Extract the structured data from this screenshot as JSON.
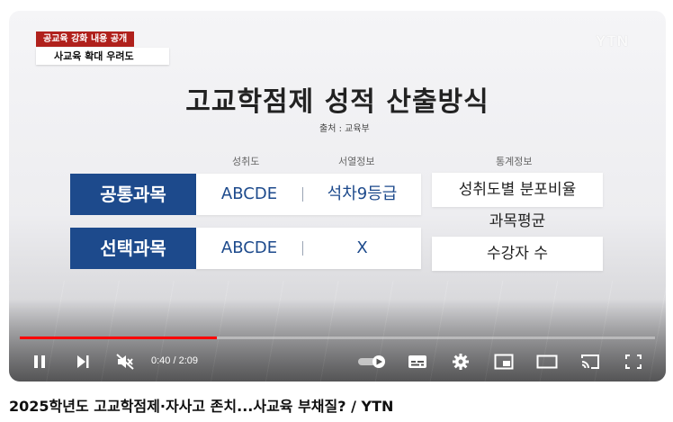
{
  "overlay": {
    "tag": "공교육 강화 내용 공개",
    "subtitle": "사교육 확대 우려도",
    "logo": "YTN"
  },
  "slide": {
    "title": "고교학점제 성적 산출방식",
    "source": "출처 : 교육부",
    "col_achievement": "성취도",
    "col_narrative": "서열정보",
    "col_stats": "통계정보",
    "rows": [
      {
        "subject": "공통과목",
        "achievement": "ABCDE",
        "rank": "석차9등급"
      },
      {
        "subject": "선택과목",
        "achievement": "ABCDE",
        "rank": "X"
      }
    ],
    "stats": [
      "성취도별 분포비율",
      "과목평균",
      "수강자 수"
    ]
  },
  "player": {
    "time": "0:40 / 2:09",
    "progress_fraction": 0.31,
    "progress_color": "#ff0000"
  },
  "video_title": "2025학년도 고교학점제·자사고 존치...사교육 부채질? / YTN",
  "colors": {
    "subject_blue": "#1d4a8c",
    "tag_red": "#b0211c"
  }
}
